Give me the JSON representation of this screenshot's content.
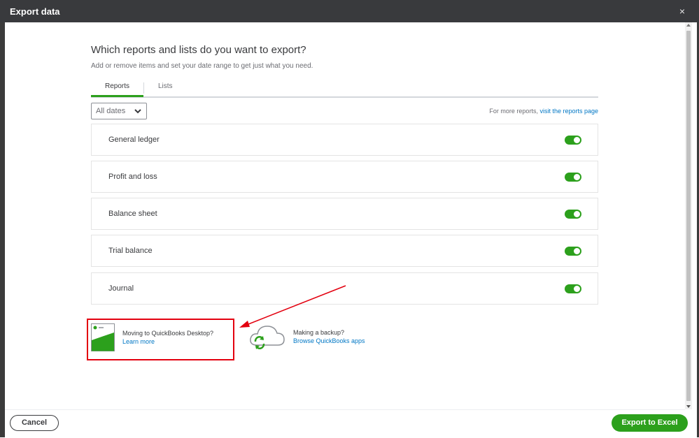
{
  "dialog": {
    "title": "Export data",
    "close_label": "×"
  },
  "content": {
    "heading": "Which reports and lists do you want to export?",
    "subheading": "Add or remove items and set your date range to get just what you need."
  },
  "tabs": [
    {
      "label": "Reports",
      "active": true
    },
    {
      "label": "Lists",
      "active": false
    }
  ],
  "date_filter": {
    "selected": "All dates"
  },
  "more_reports": {
    "text": "For more reports, ",
    "link": "visit the reports page"
  },
  "reports": [
    {
      "label": "General ledger",
      "enabled": true
    },
    {
      "label": "Profit and loss",
      "enabled": true
    },
    {
      "label": "Balance sheet",
      "enabled": true
    },
    {
      "label": "Trial balance",
      "enabled": true
    },
    {
      "label": "Journal",
      "enabled": true
    }
  ],
  "promos": [
    {
      "title": "Moving to QuickBooks Desktop?",
      "link": "Learn more",
      "icon": "desktop-window-icon"
    },
    {
      "title": "Making a backup?",
      "link": "Browse QuickBooks apps",
      "icon": "cloud-sync-icon"
    }
  ],
  "footer": {
    "cancel_label": "Cancel",
    "export_label": "Export to Excel"
  },
  "colors": {
    "accent": "#2ca01c",
    "link": "#0077c5",
    "titlebar": "#393a3d",
    "highlight": "#e3000f"
  }
}
